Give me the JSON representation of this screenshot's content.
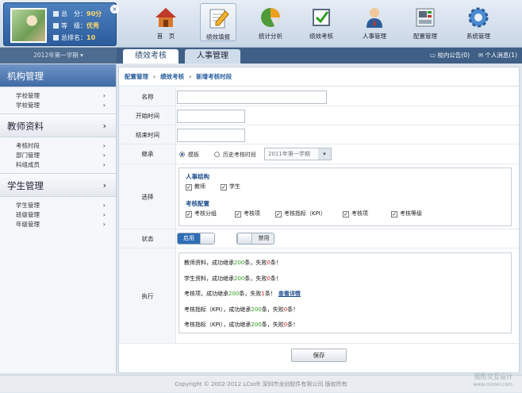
{
  "profile": {
    "total_label": "总　分：",
    "total_value": "90分",
    "level_label": "等　级：",
    "level_value": "优秀",
    "rank_label": "总排名：",
    "rank_value": "10"
  },
  "semester": "2012年第一学期 ▾",
  "nav": [
    {
      "label": "首　页",
      "icon": "home-icon"
    },
    {
      "label": "绩效填报",
      "icon": "pencil-form-icon"
    },
    {
      "label": "统计分析",
      "icon": "pie-chart-icon"
    },
    {
      "label": "绩效考核",
      "icon": "checkbox-icon"
    },
    {
      "label": "人事管理",
      "icon": "person-icon"
    },
    {
      "label": "配置管理",
      "icon": "config-panel-icon"
    },
    {
      "label": "系统管理",
      "icon": "gear-icon"
    }
  ],
  "tabs": [
    "绩效考核",
    "人事管理"
  ],
  "header_links": {
    "notice": "校内公告(0)",
    "message": "个人消息(1)"
  },
  "sidebar": [
    {
      "title": "机构管理",
      "items": [
        "学校管理",
        "学校管理"
      ]
    },
    {
      "title": "教师资料",
      "items": [
        "考核时段",
        "部门管理",
        "科组成员"
      ]
    },
    {
      "title": "学生管理",
      "items": [
        "学生管理",
        "班级管理",
        "年级管理"
      ]
    }
  ],
  "breadcrumb": [
    "配置管理",
    "绩效考核",
    "新增考核时段"
  ],
  "form": {
    "name_label": "名称",
    "start_label": "开始时间",
    "end_label": "结束时间",
    "inherit_label": "继承",
    "inherit_opt1": "模板",
    "inherit_opt2": "历史考核时段",
    "inherit_select": "2011年第一学期",
    "choose_label": "选择",
    "personnel_title": "人事结构",
    "personnel_items": [
      "教师",
      "学生"
    ],
    "config_title": "考核配置",
    "config_items": [
      "考核分组",
      "考核项",
      "考核指标（KPI）",
      "考核项",
      "考核等级"
    ],
    "status_label": "状态",
    "enable_label": "启用",
    "disable_label": "禁用",
    "exec_label": "执行",
    "log": [
      {
        "a": "教师资料，成功继承",
        "n": "200",
        "b": "条，失败",
        "f": "0",
        "c": "条！",
        "link": ""
      },
      {
        "a": "学生资料，成功继承",
        "n": "200",
        "b": "条，失败",
        "f": "0",
        "c": "条！",
        "link": ""
      },
      {
        "a": "考核项，成功继承",
        "n": "200",
        "b": "条，失败",
        "f": "1",
        "c": "条！",
        "link": "查看详情"
      },
      {
        "a": "考核指标（KPI），成功继承",
        "n": "200",
        "b": "条，失败",
        "f": "0",
        "c": "条！",
        "link": ""
      },
      {
        "a": "考核指标（KPI），成功继承",
        "n": "200",
        "b": "条，失败",
        "f": "0",
        "c": "条！",
        "link": ""
      }
    ],
    "save_label": "保存"
  },
  "footer": "Copyright © 2002-2012 LCsoft 深圳市龙创软件有限公司 版权所有",
  "watermark": {
    "line1": "图形交互设计",
    "line2": "www.moooi.com"
  },
  "colors": {
    "accent": "#2f6db5",
    "success": "#2f9c1f",
    "error": "#d0211b"
  }
}
